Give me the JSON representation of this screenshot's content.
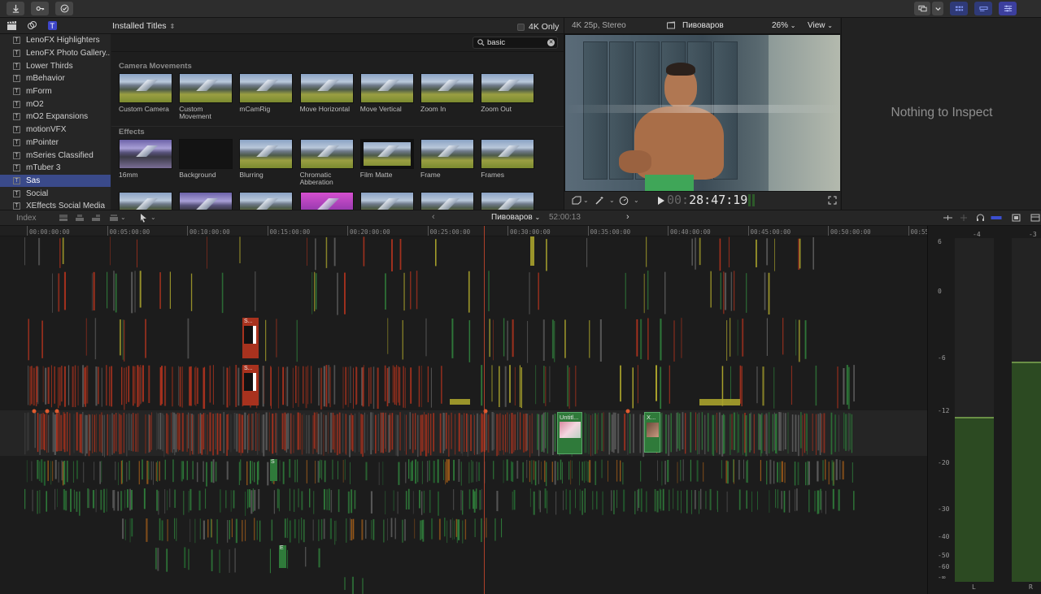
{
  "toolbar": {
    "icons": [
      "import-arrow-icon",
      "keyword-icon",
      "check-circle-icon"
    ],
    "right_icons": [
      "window-layout-icon",
      "chevron-down-icon",
      "browser-toggle-icon",
      "timeline-toggle-icon",
      "inspector-toggle-icon"
    ]
  },
  "browser": {
    "filter_label": "Installed Titles",
    "fourk_only_label": "4K Only",
    "search_value": "basic",
    "sidebar_items": [
      {
        "label": "LenoFX Highlighters"
      },
      {
        "label": "LenoFX Photo Gallery..."
      },
      {
        "label": "Lower Thirds"
      },
      {
        "label": "mBehavior"
      },
      {
        "label": "mForm"
      },
      {
        "label": "mO2"
      },
      {
        "label": "mO2 Expansions"
      },
      {
        "label": "motionVFX"
      },
      {
        "label": "mPointer"
      },
      {
        "label": "mSeries Classified"
      },
      {
        "label": "mTuber 3"
      },
      {
        "label": "Sas",
        "selected": true
      },
      {
        "label": "Social"
      },
      {
        "label": "XEffects Social Media"
      }
    ],
    "sections": [
      {
        "title": "Camera Movements",
        "items": [
          {
            "label": "Custom Camera"
          },
          {
            "label": "Custom Movement"
          },
          {
            "label": "mCamRig"
          },
          {
            "label": "Move Horizontal"
          },
          {
            "label": "Move Vertical"
          },
          {
            "label": "Zoom In"
          },
          {
            "label": "Zoom Out"
          }
        ]
      },
      {
        "title": "Effects",
        "items": [
          {
            "label": "16mm",
            "style": "purple"
          },
          {
            "label": "Background",
            "style": "dark"
          },
          {
            "label": "Blurring",
            "style": "normal"
          },
          {
            "label": "Chromatic Abberation",
            "style": "normal"
          },
          {
            "label": "Film Matte",
            "style": "film"
          },
          {
            "label": "Frame",
            "style": "normal"
          },
          {
            "label": "Frames",
            "style": "normal"
          }
        ]
      }
    ]
  },
  "viewer": {
    "format": "4K 25p, Stereo",
    "project_name": "Пивоваров",
    "zoom": "26%",
    "view_label": "View",
    "timecode_dim": "00:",
    "timecode": "28:47:19"
  },
  "inspector": {
    "empty_text": "Nothing to Inspect"
  },
  "timeline": {
    "index_label": "Index",
    "project_name": "Пивоваров",
    "duration": "52:00:13",
    "ruler": [
      "00:00:00:00",
      "00:05:00:00",
      "00:10:00:00",
      "00:15:00:00",
      "00:20:00:00",
      "00:25:00:00",
      "00:30:00:00",
      "00:35:00:00",
      "00:40:00:00",
      "00:45:00:00",
      "00:50:00:00",
      "00:55"
    ],
    "clip_labels": [
      "Untitl...",
      "X...",
      "S",
      "E",
      "S...",
      "S..."
    ]
  },
  "meters": {
    "top_labels": [
      "-4",
      "-3"
    ],
    "scale": [
      "6",
      "0",
      "-6",
      "-12",
      "-20",
      "-30",
      "-40",
      "-50",
      "-60",
      "-∞"
    ],
    "channels": [
      "L",
      "R"
    ],
    "levels": [
      0.48,
      0.64
    ],
    "colors": {
      "fill": "#2c4a22",
      "peak": "#6a8f46"
    }
  },
  "colors": {
    "accent_blue": "#3a4a8a",
    "clip_red": "#a8321e",
    "clip_green": "#2f7a3a",
    "clip_yellow": "#a9a22c",
    "clip_gray": "#5a5a5a",
    "playhead": "#d24a2e"
  }
}
